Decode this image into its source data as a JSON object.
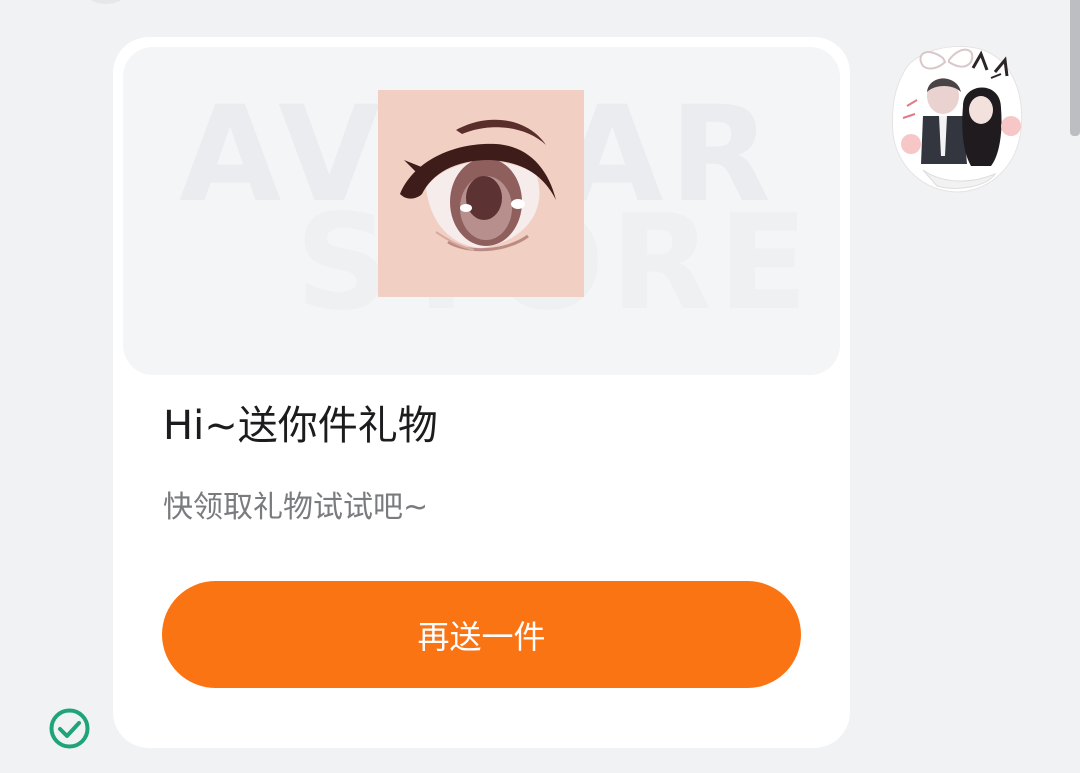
{
  "card": {
    "watermark_line1": "AVATAR",
    "watermark_line2": "STORE",
    "thumbnail_icon": "anime-eye-icon",
    "title": "Hi~送你件礼物",
    "subtitle": "快领取礼物试试吧~",
    "button_label": "再送一件"
  },
  "sender": {
    "avatar_icon": "anime-couple-sticker-avatar"
  },
  "status": {
    "icon": "check-circle-icon"
  },
  "colors": {
    "accent": "#fb7413",
    "background": "#f1f2f4",
    "card": "#ffffff",
    "check": "#1fa37a"
  }
}
